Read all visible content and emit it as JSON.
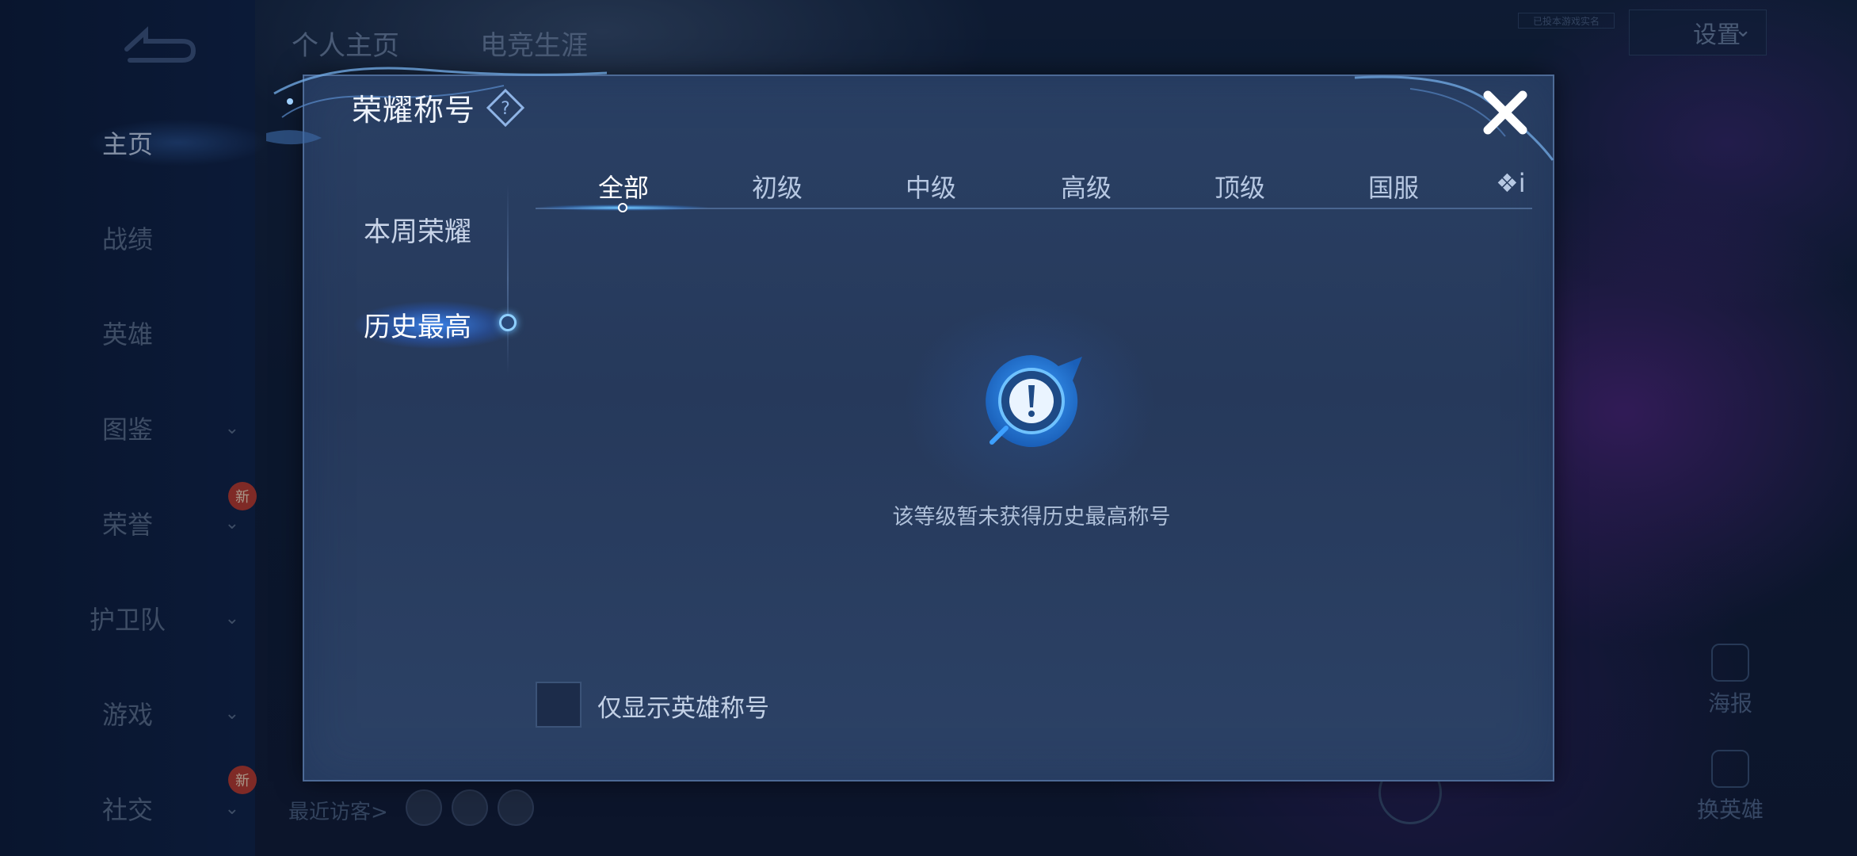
{
  "background": {
    "top_tabs": [
      "个人主页",
      "电竞生涯"
    ],
    "settings_label": "设置",
    "tiny_note": "已投本游戏实名",
    "left_nav": {
      "items": [
        {
          "label": "主页",
          "active": true,
          "has_chevron": false,
          "new": false
        },
        {
          "label": "战绩",
          "active": false,
          "has_chevron": false,
          "new": false
        },
        {
          "label": "英雄",
          "active": false,
          "has_chevron": false,
          "new": false
        },
        {
          "label": "图鉴",
          "active": false,
          "has_chevron": true,
          "new": false
        },
        {
          "label": "荣誉",
          "active": false,
          "has_chevron": true,
          "new": true
        },
        {
          "label": "护卫队",
          "active": false,
          "has_chevron": true,
          "new": false
        },
        {
          "label": "游戏",
          "active": false,
          "has_chevron": true,
          "new": false
        },
        {
          "label": "社交",
          "active": false,
          "has_chevron": true,
          "new": true
        }
      ],
      "new_badge": "新"
    },
    "recent_visitors": "最近访客>",
    "right_actions": {
      "poster": "海报",
      "switch_hero": "换英雄"
    }
  },
  "dialog": {
    "title": "荣耀称号",
    "help_icon": "question-diamond-icon",
    "close_icon": "close-x-icon",
    "side_tabs": [
      {
        "label": "本周荣耀",
        "active": false
      },
      {
        "label": "历史最高",
        "active": true
      }
    ],
    "tabs": [
      {
        "label": "全部",
        "active": true
      },
      {
        "label": "初级",
        "active": false
      },
      {
        "label": "中级",
        "active": false
      },
      {
        "label": "高级",
        "active": false
      },
      {
        "label": "顶级",
        "active": false
      },
      {
        "label": "国服",
        "active": false
      }
    ],
    "more_tab_partial": "❖i",
    "empty_state_text": "该等级暂未获得历史最高称号",
    "checkbox": {
      "label": "仅显示英雄称号",
      "checked": false
    }
  },
  "colors": {
    "dialog_bg": "#2a4064",
    "accent": "#6ec6ff",
    "new_badge": "#c0392b"
  }
}
